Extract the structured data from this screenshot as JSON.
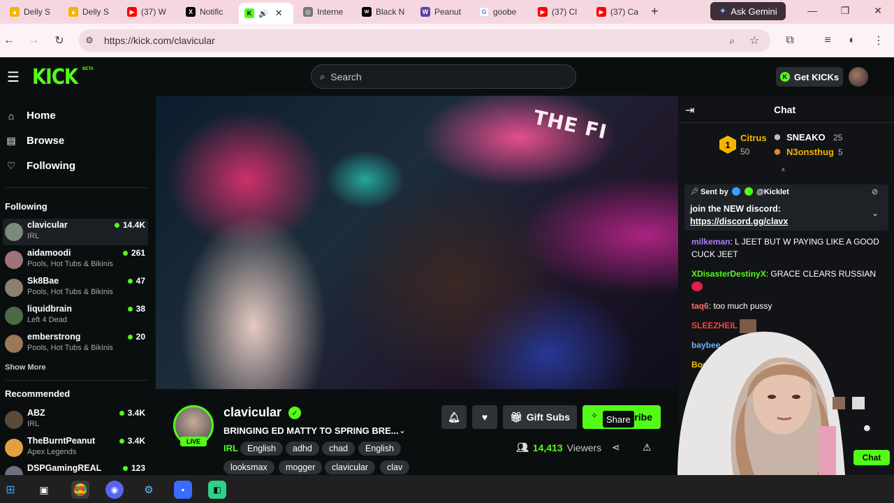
{
  "browser": {
    "tabs": [
      {
        "label": "Delly S",
        "icon": "google-drive-icon",
        "color": "#f4b400"
      },
      {
        "label": "Delly S",
        "icon": "google-drive-icon",
        "color": "#f4b400"
      },
      {
        "label": "(37) W",
        "icon": "youtube-icon",
        "color": "#ff0000"
      },
      {
        "label": "Notific",
        "icon": "x-icon",
        "color": "#000000"
      },
      {
        "label": "",
        "icon": "kick-icon",
        "color": "#53fc18",
        "active": true
      },
      {
        "label": "Interne",
        "icon": "globe-icon",
        "color": "#666666"
      },
      {
        "label": "Black N",
        "icon": "wix-icon",
        "color": "#000000"
      },
      {
        "label": "Peanut",
        "icon": "wiki-icon",
        "color": "#5b3fa8"
      },
      {
        "label": "goobe",
        "icon": "google-icon",
        "color": "#4285f4"
      },
      {
        "label": "(37) Cl",
        "icon": "youtube-icon",
        "color": "#ff0000"
      },
      {
        "label": "(37) Ca",
        "icon": "youtube-icon",
        "color": "#ff0000"
      }
    ],
    "new_tab": "+",
    "ask_gemini": "Ask Gemini",
    "url": "https://kick.com/clavicular"
  },
  "header": {
    "logo": "KICK",
    "logo_badge": "BETA",
    "search_placeholder": "Search",
    "get_kicks": "Get KICKs"
  },
  "sidebar": {
    "nav": [
      {
        "label": "Home",
        "icon": "home-icon"
      },
      {
        "label": "Browse",
        "icon": "browse-icon"
      },
      {
        "label": "Following",
        "icon": "heart-icon"
      }
    ],
    "following_heading": "Following",
    "following": [
      {
        "name": "clavicular",
        "category": "IRL",
        "viewers": "14.4K",
        "selected": true,
        "color": "#7b8a7d"
      },
      {
        "name": "aidamoodi",
        "category": "Pools, Hot Tubs & Bikinis",
        "viewers": "261",
        "color": "#a0727a"
      },
      {
        "name": "Sk8Bae",
        "category": "Pools, Hot Tubs & Bikinis",
        "viewers": "47",
        "color": "#8a8070"
      },
      {
        "name": "liquidbrain",
        "category": "Left 4 Dead",
        "viewers": "38",
        "color": "#4a6a48"
      },
      {
        "name": "emberstrong",
        "category": "Pools, Hot Tubs & Bikinis",
        "viewers": "20",
        "color": "#9a7858"
      }
    ],
    "show_more": "Show More",
    "recommended_heading": "Recommended",
    "recommended": [
      {
        "name": "ABZ",
        "category": "IRL",
        "viewers": "3.4K",
        "color": "#5a4a3a"
      },
      {
        "name": "TheBurntPeanut",
        "category": "Apex Legends",
        "viewers": "3.4K",
        "color": "#e0a040"
      },
      {
        "name": "DSPGamingREAL",
        "category": "",
        "viewers": "123",
        "color": "#707080"
      }
    ]
  },
  "video": {
    "caption_text": "THE FI"
  },
  "stream": {
    "streamer": "clavicular",
    "live": "LIVE",
    "title": "BRINGING ED MATTY TO SPRING BRE...",
    "category": "IRL",
    "tags": [
      "English",
      "adhd",
      "chad",
      "English",
      "looksmax",
      "mogger",
      "clavicular",
      "clav"
    ],
    "gift_subs": "Gift Subs",
    "subscribe_partial": "ribe",
    "share_tooltip": "Share",
    "viewers_count": "14,413",
    "viewers_label": "Viewers"
  },
  "chat": {
    "title": "Chat",
    "leaderboard": [
      {
        "rank": "1",
        "name": "Citrus",
        "amount": "50",
        "color": "#f2b500"
      },
      {
        "name": "SNEAKO",
        "amount": "25",
        "color": "#ffffff"
      },
      {
        "name": "N3onsthug",
        "amount": "5",
        "color": "#f2b500"
      }
    ],
    "pinned": {
      "sent_by": "Sent by",
      "user": "@Kicklet",
      "text": "join the NEW discord:",
      "link": "https://discord.gg/clavx"
    },
    "messages": [
      {
        "user": "milkeman",
        "text": "L JEET BUT W PAYING LIKE A GOOD CUCK JEET",
        "color": "#b07cff"
      },
      {
        "user": "XDisasterDestinyX",
        "text": "GRACE CLEARS RUSSIAN",
        "color": "#53fc18"
      },
      {
        "user": "taq6",
        "text": "too much pussy",
        "color": "#ff6a6a"
      },
      {
        "user": "SLEEZHEIL",
        "text": "",
        "color": "#ff4040"
      },
      {
        "user": "baybee",
        "text": "",
        "color": "#6ab0ff"
      },
      {
        "user": "Booty",
        "text": "",
        "color": "#f2c400"
      }
    ],
    "send": "Chat"
  }
}
